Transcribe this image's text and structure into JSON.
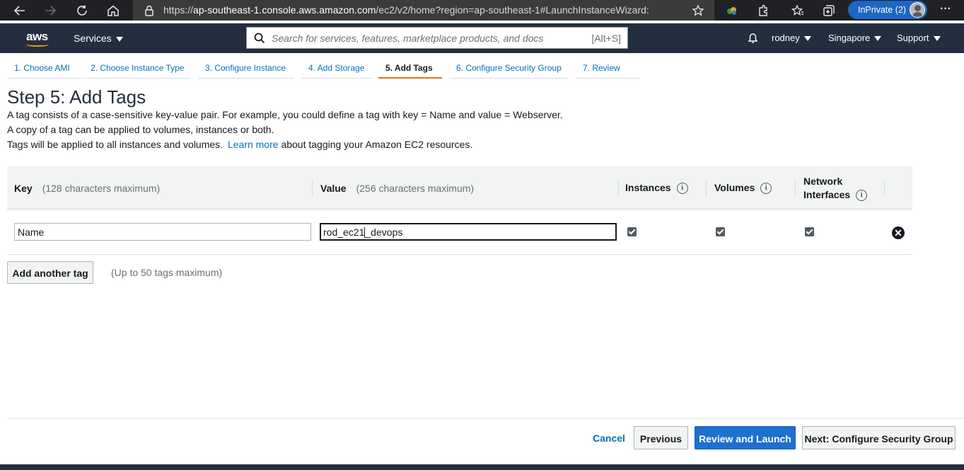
{
  "browser": {
    "url_prefix": "https://",
    "url_host": "ap-southeast-1.console.aws.amazon.com",
    "url_path": "/ec2/v2/home?region=ap-southeast-1#LaunchInstanceWizard:",
    "inprivate_label": "InPrivate (2)",
    "more_label": "···"
  },
  "aws_nav": {
    "logo_text": "aws",
    "services_label": "Services",
    "search_placeholder": "Search for services, features, marketplace products, and docs",
    "search_shortcut": "[Alt+S]",
    "user_label": "rodney",
    "region_label": "Singapore",
    "support_label": "Support",
    "brand_color": "#ff9900",
    "nav_bg": "#232f3e"
  },
  "wizard_tabs": [
    {
      "label": "1. Choose AMI",
      "active": false
    },
    {
      "label": "2. Choose Instance Type",
      "active": false
    },
    {
      "label": "3. Configure Instance",
      "active": false
    },
    {
      "label": "4. Add Storage",
      "active": false
    },
    {
      "label": "5. Add Tags",
      "active": true
    },
    {
      "label": "6. Configure Security Group",
      "active": false
    },
    {
      "label": "7. Review",
      "active": false
    }
  ],
  "page": {
    "title": "Step 5: Add Tags",
    "desc_line1": "A tag consists of a case-sensitive key-value pair. For example, you could define a tag with key = Name and value = Webserver.",
    "desc_line2": "A copy of a tag can be applied to volumes, instances or both.",
    "desc_line3_pre": "Tags will be applied to all instances and volumes.",
    "desc_line3_link": "Learn more",
    "desc_line3_post": "about tagging your Amazon EC2 resources."
  },
  "table": {
    "headers": {
      "key": "Key",
      "key_hint": "(128 characters maximum)",
      "value": "Value",
      "value_hint": "(256 characters maximum)",
      "instances": "Instances",
      "volumes": "Volumes",
      "network_line1": "Network",
      "network_line2": "Interfaces",
      "info_glyph": "i"
    },
    "rows": [
      {
        "key": "Name",
        "value_before_cursor": "rod_ec21",
        "value_after_cursor": "_devops",
        "instances": true,
        "volumes": true,
        "network_interfaces": true,
        "remove_glyph": "✕"
      }
    ]
  },
  "add_tag": {
    "button_label": "Add another tag",
    "note": "(Up to 50 tags maximum)"
  },
  "footer": {
    "cancel": "Cancel",
    "previous": "Previous",
    "review_launch": "Review and Launch",
    "next": "Next: Configure Security Group",
    "primary_color": "#1d6fd0"
  }
}
